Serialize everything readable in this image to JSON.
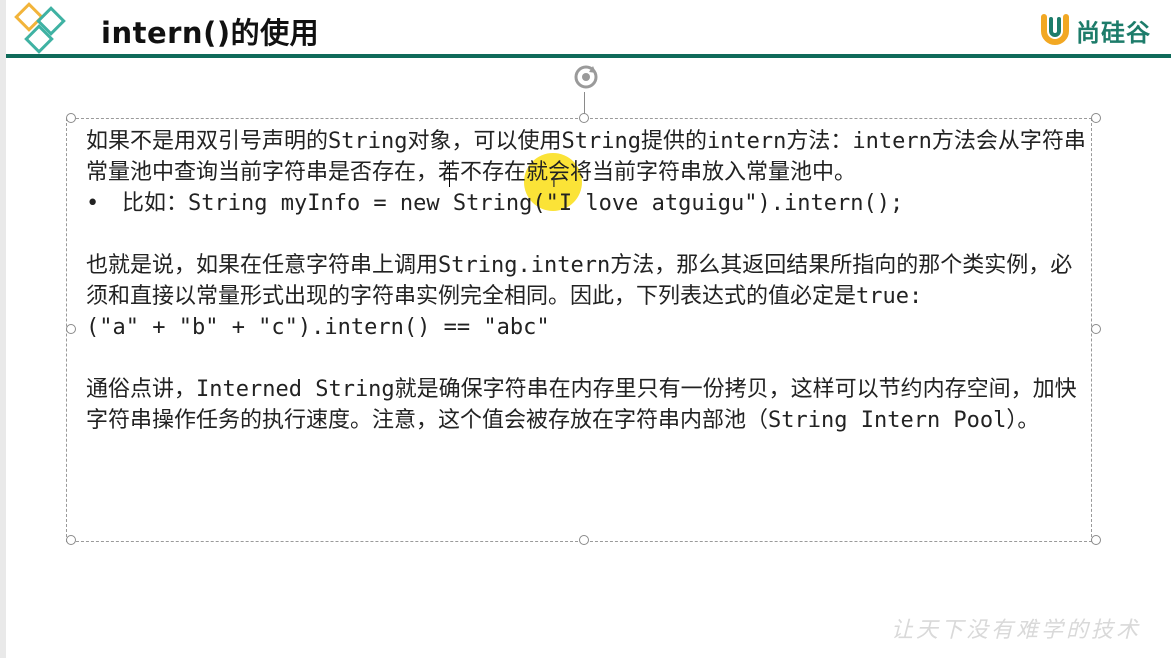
{
  "slide": {
    "title": "intern()的使用",
    "brand": {
      "logo_icon": "u-logo-icon",
      "name": "尚硅谷",
      "color": "#1d7c6a"
    },
    "accent_color": "#0f6b5a",
    "watermark": "让天下没有难学的技术"
  },
  "textbox": {
    "paragraph1": "如果不是用双引号声明的String对象，可以使用String提供的intern方法：intern方法会从字符串常量池中查询当前字符串是否存在，若不存在就会将当前字符串放入常量池中。",
    "bullet": "比如：String myInfo = new String(\"I love atguigu\").intern();",
    "bullet_marker": "•",
    "paragraph2": "也就是说，如果在任意字符串上调用String.intern方法，那么其返回结果所指向的那个类实例，必须和直接以常量形式出现的字符串实例完全相同。因此，下列表达式的值必定是true:",
    "code": "(\"a\" + \"b\" + \"c\").intern() == \"abc\"",
    "paragraph3": "通俗点讲，Interned String就是确保字符串在内存里只有一份拷贝，这样可以节约内存空间，加快字符串操作任务的执行速度。注意，这个值会被存放在字符串内部池（String Intern Pool）。"
  },
  "cursor": {
    "highlight_color": "#fade14"
  }
}
